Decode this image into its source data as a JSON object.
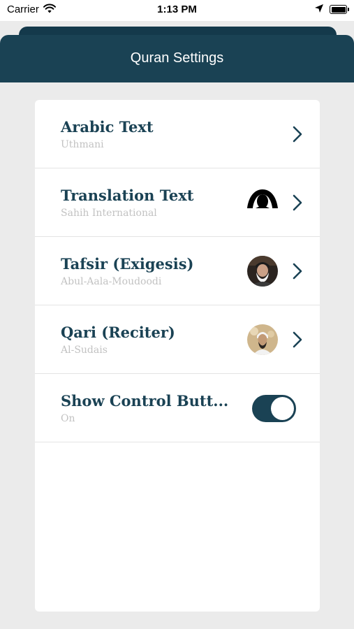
{
  "status_bar": {
    "carrier": "Carrier",
    "time": "1:13 PM",
    "icons": [
      "wifi-icon",
      "location-arrow-icon",
      "battery-icon"
    ]
  },
  "nav": {
    "title": "Quran Settings"
  },
  "settings": [
    {
      "title": "Arabic Text",
      "value": "Uthmani",
      "accessory": "chevron-right-icon"
    },
    {
      "title": "Translation Text",
      "value": "Sahih International",
      "accessory": "chevron-right-icon",
      "thumbnail": "translator-avatar"
    },
    {
      "title": "Tafsir (Exigesis)",
      "value": "Abul-Aala-Moudoodi",
      "accessory": "chevron-right-icon",
      "thumbnail": "scholar-avatar"
    },
    {
      "title": "Qari (Reciter)",
      "value": "Al-Sudais",
      "accessory": "chevron-right-icon",
      "thumbnail": "reciter-avatar"
    },
    {
      "title": "Show Control Butt...",
      "value": "On",
      "accessory": "toggle-switch",
      "toggle_on": true
    }
  ],
  "colors": {
    "accent": "#1a4254",
    "background": "#ebebeb",
    "subtitle": "#c2c2c2"
  }
}
